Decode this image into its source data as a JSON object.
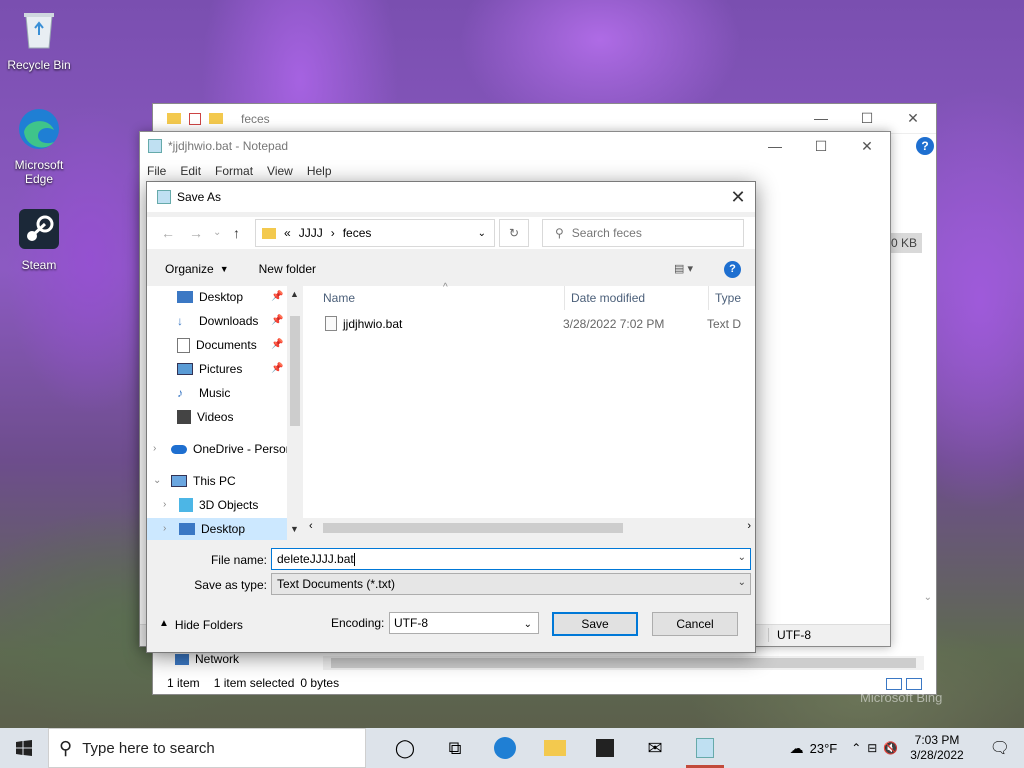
{
  "desktop": {
    "icons": [
      {
        "label": "Recycle Bin",
        "icon": "recycle-bin-icon"
      },
      {
        "label": "Microsoft Edge",
        "icon": "edge-icon"
      },
      {
        "label": "Steam",
        "icon": "steam-icon"
      }
    ],
    "watermark": "Microsoft Bing"
  },
  "explorer": {
    "title": "feces",
    "size_cell": "0 KB",
    "nav_network": "Network",
    "status": {
      "items": "1 item",
      "selected": "1 item selected",
      "bytes": "0 bytes"
    }
  },
  "notepad": {
    "title": "*jjdjhwio.bat - Notepad",
    "menu": [
      "File",
      "Edit",
      "Format",
      "View",
      "Help"
    ],
    "status_encoding": "UTF-8"
  },
  "save_dialog": {
    "title": "Save As",
    "address": {
      "prefix": "«",
      "parts": [
        "JJJJ",
        "feces"
      ]
    },
    "search_placeholder": "Search feces",
    "toolbar": {
      "organize": "Organize",
      "new_folder": "New folder"
    },
    "nav_items": [
      {
        "label": "Desktop",
        "icon": "desktop-icon",
        "pinned": true
      },
      {
        "label": "Downloads",
        "icon": "downloads-icon",
        "pinned": true
      },
      {
        "label": "Documents",
        "icon": "documents-icon",
        "pinned": true
      },
      {
        "label": "Pictures",
        "icon": "pictures-icon",
        "pinned": true
      },
      {
        "label": "Music",
        "icon": "music-icon",
        "pinned": false
      },
      {
        "label": "Videos",
        "icon": "videos-icon",
        "pinned": false
      },
      {
        "label": "OneDrive - Persor",
        "icon": "onedrive-icon",
        "pinned": false
      },
      {
        "label": "This PC",
        "icon": "this-pc-icon",
        "pinned": false
      },
      {
        "label": "3D Objects",
        "icon": "3d-objects-icon",
        "pinned": false
      },
      {
        "label": "Desktop",
        "icon": "desktop-icon",
        "pinned": false
      }
    ],
    "columns": [
      "Name",
      "Date modified",
      "Type"
    ],
    "files": [
      {
        "name": "jjdjhwio.bat",
        "date": "3/28/2022 7:02 PM",
        "type": "Text D"
      }
    ],
    "file_name_label": "File name:",
    "file_name_value": "deleteJJJJ.bat",
    "save_type_label": "Save as type:",
    "save_type_value": "Text Documents (*.txt)",
    "hide_folders": "Hide Folders",
    "encoding_label": "Encoding:",
    "encoding_value": "UTF-8",
    "save_button": "Save",
    "cancel_button": "Cancel"
  },
  "taskbar": {
    "search_placeholder": "Type here to search",
    "weather": "23°F",
    "time": "7:03 PM",
    "date": "3/28/2022"
  },
  "colors": {
    "accent": "#0078d7",
    "selection": "#cce8ff",
    "help_blue": "#1e6fd0"
  }
}
